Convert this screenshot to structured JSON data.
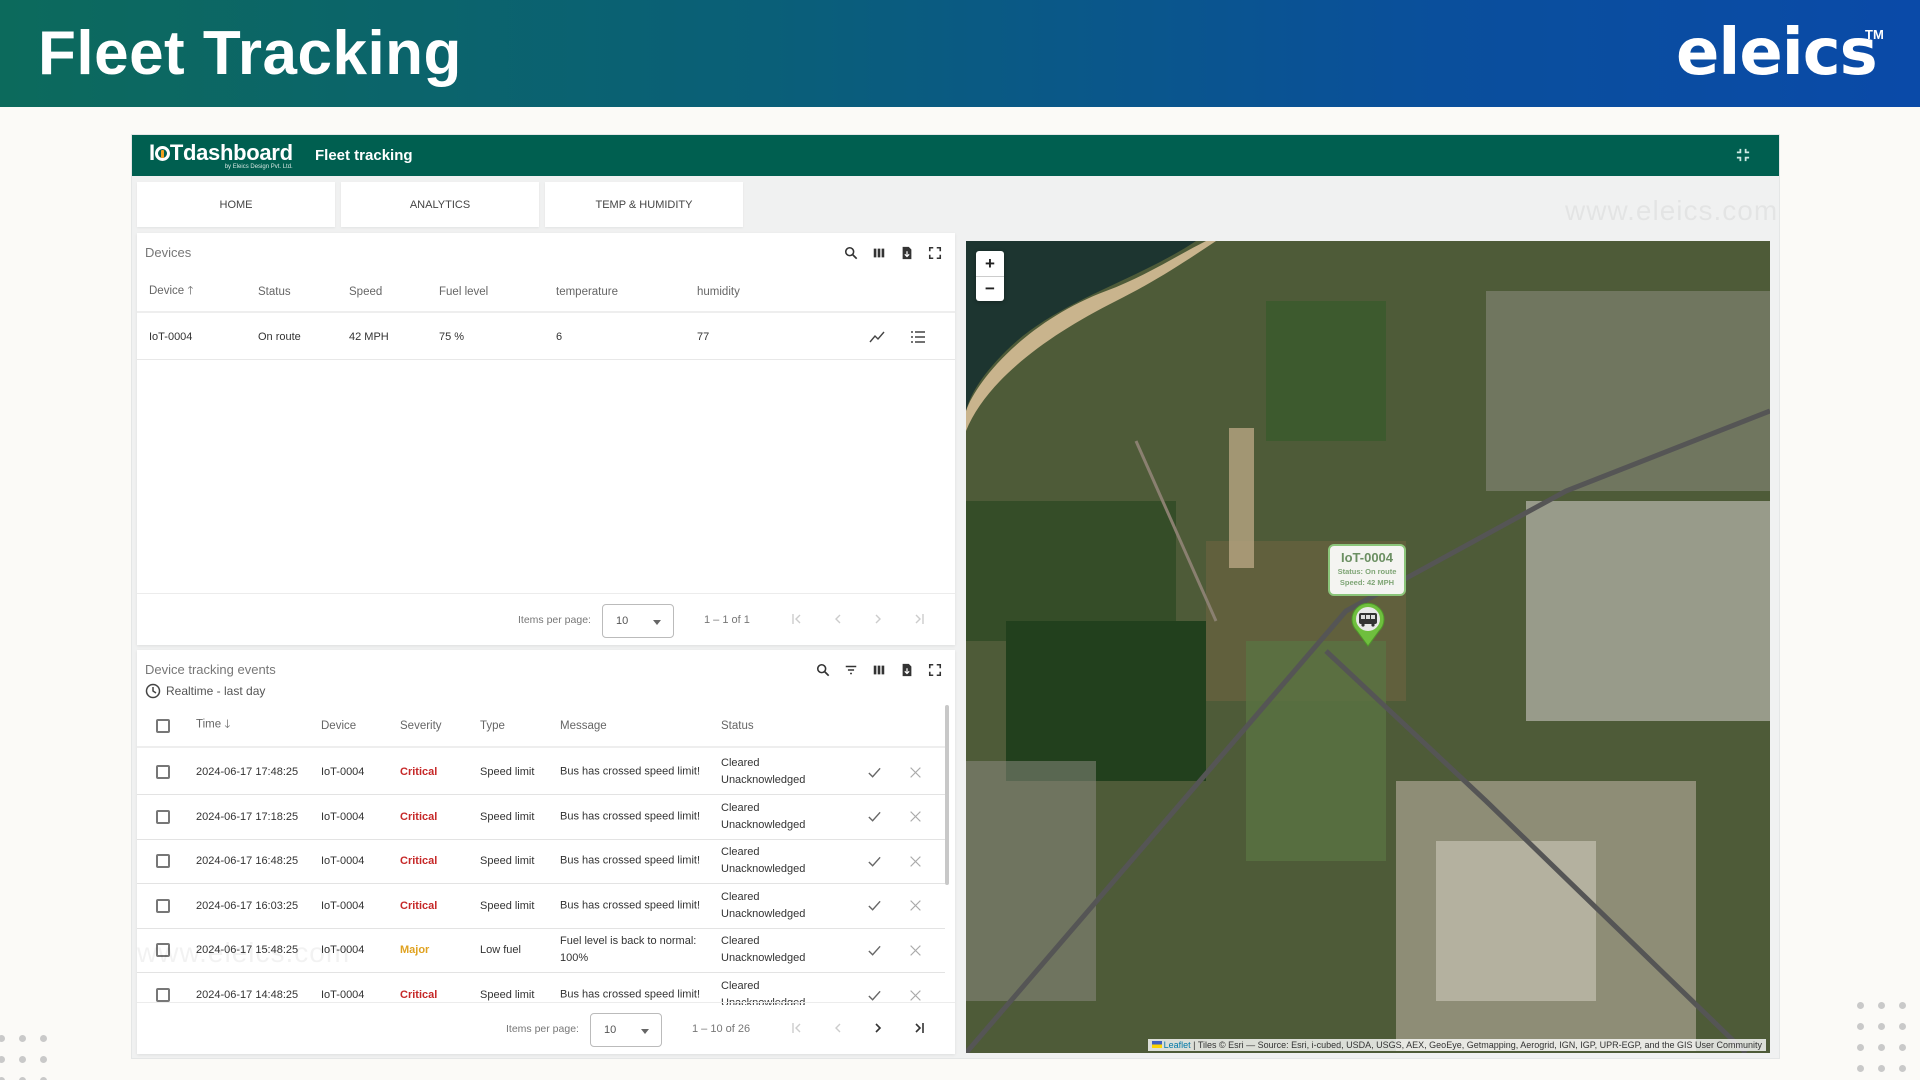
{
  "banner": {
    "title": "Fleet Tracking",
    "logo_text": "eleics",
    "trademark": "TM",
    "watermark": "www.eleics.com"
  },
  "app": {
    "logo_main_pre": "I",
    "logo_main_post": "Tdashboard",
    "logo_sub": "by Eleics Design Pvt. Ltd.",
    "title": "Fleet tracking",
    "collapse_icon": "fullscreen-exit-icon",
    "accent_color": "#005f50"
  },
  "tabs": [
    {
      "label": "HOME"
    },
    {
      "label": "ANALYTICS"
    },
    {
      "label": "TEMP & HUMIDITY"
    }
  ],
  "devices": {
    "title": "Devices",
    "tools": [
      "search-icon",
      "columns-icon",
      "export-icon",
      "fullscreen-icon"
    ],
    "columns": [
      "Device",
      "Status",
      "Speed",
      "Fuel level",
      "temperature",
      "humidity"
    ],
    "sort_column": "Device",
    "sort_direction": "ascending",
    "rows": [
      {
        "device": "IoT-0004",
        "status": "On route",
        "speed": "42 MPH",
        "fuel": "75 %",
        "temperature": "6",
        "humidity": "77"
      }
    ],
    "pager": {
      "items_label": "Items per page:",
      "page_size": "10",
      "range": "1 – 1 of 1"
    }
  },
  "events": {
    "title": "Device tracking events",
    "subtitle": "Realtime - last day",
    "tools": [
      "search-icon",
      "filter-icon",
      "columns-icon",
      "export-icon",
      "fullscreen-icon"
    ],
    "columns": [
      "Time",
      "Device",
      "Severity",
      "Type",
      "Message",
      "Status"
    ],
    "sort_column": "Time",
    "sort_direction": "descending",
    "severity_colors": {
      "Critical": "#c62828",
      "Major": "#e0a220"
    },
    "rows": [
      {
        "time": "2024-06-17 17:48:25",
        "device": "IoT-0004",
        "severity": "Critical",
        "type": "Speed limit",
        "message": "Bus has crossed speed limit!",
        "status1": "Cleared",
        "status2": "Unacknowledged"
      },
      {
        "time": "2024-06-17 17:18:25",
        "device": "IoT-0004",
        "severity": "Critical",
        "type": "Speed limit",
        "message": "Bus has crossed speed limit!",
        "status1": "Cleared",
        "status2": "Unacknowledged"
      },
      {
        "time": "2024-06-17 16:48:25",
        "device": "IoT-0004",
        "severity": "Critical",
        "type": "Speed limit",
        "message": "Bus has crossed speed limit!",
        "status1": "Cleared",
        "status2": "Unacknowledged"
      },
      {
        "time": "2024-06-17 16:03:25",
        "device": "IoT-0004",
        "severity": "Critical",
        "type": "Speed limit",
        "message": "Bus has crossed speed limit!",
        "status1": "Cleared",
        "status2": "Unacknowledged"
      },
      {
        "time": "2024-06-17 15:48:25",
        "device": "IoT-0004",
        "severity": "Major",
        "type": "Low fuel",
        "message": "Fuel level is back to normal: 100%",
        "status1": "Cleared",
        "status2": "Unacknowledged"
      },
      {
        "time": "2024-06-17 14:48:25",
        "device": "IoT-0004",
        "severity": "Critical",
        "type": "Speed limit",
        "message": "Bus has crossed speed limit!",
        "status1": "Cleared",
        "status2": "Unacknowledged"
      }
    ],
    "pager": {
      "items_label": "Items per page:",
      "page_size": "10",
      "range": "1 – 10 of 26"
    }
  },
  "map": {
    "zoom_in": "+",
    "zoom_out": "−",
    "popup": {
      "device": "IoT-0004",
      "status": "Status: On route",
      "speed": "Speed: 42 MPH"
    },
    "marker_icon": "bus-icon",
    "attribution_link": "Leaflet",
    "attribution_text": " | Tiles © Esri — Source: Esri, i-cubed, USDA, USGS, AEX, GeoEye, Getmapping, Aerogrid, IGN, IGP, UPR-EGP, and the GIS User Community"
  }
}
